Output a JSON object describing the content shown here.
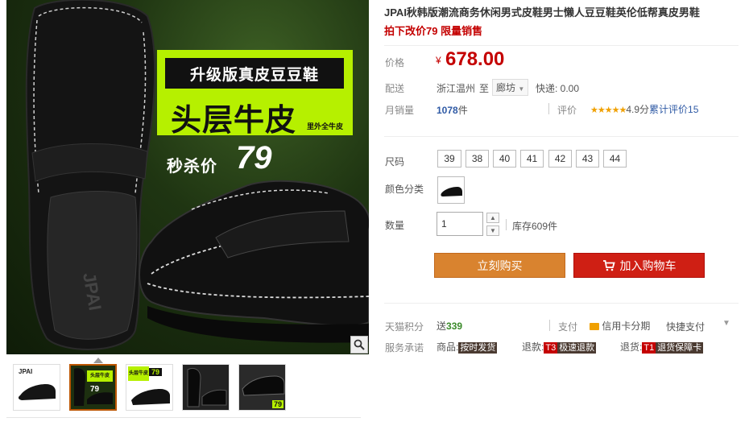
{
  "gallery": {
    "promo_headline": "升级版真皮豆豆鞋",
    "promo_big": "头层牛皮",
    "promo_small": "里外全牛皮",
    "promo_flash_label": "秒杀价",
    "promo_flash_price": "79",
    "shoe_brand_print": "JPAI",
    "thumbs": [
      {
        "label": "JPAI"
      },
      {
        "label": "头层牛皮",
        "price": "79"
      },
      {
        "label": "头层牛皮",
        "price": "79"
      },
      {
        "label": ""
      },
      {
        "label": "",
        "price": "79"
      }
    ]
  },
  "product": {
    "title": "JPAI秋韩版潮流商务休闲男式皮鞋男士懒人豆豆鞋英伦低帮真皮男鞋",
    "subtitle": "拍下改价79 限量销售",
    "price_label": "价格",
    "currency": "¥",
    "price": "678.00",
    "shipping_label": "配送",
    "ship_from": "浙江温州",
    "ship_to_word": "至",
    "ship_dest": "廊坊",
    "ship_fee": "快递: 0.00",
    "monthly_sales_label": "月销量",
    "monthly_sales_value": "1078",
    "monthly_sales_unit": "件",
    "review_label": "评价",
    "stars": "★★★★★",
    "rating": "4.9分",
    "review_count_label": "累计评价",
    "review_count": "15",
    "size_label": "尺码",
    "sizes": [
      "39",
      "38",
      "40",
      "41",
      "42",
      "43",
      "44"
    ],
    "color_label": "颜色分类",
    "qty_label": "数量",
    "qty_value": "1",
    "stock": "库存609件",
    "buy_now": "立刻购买",
    "add_cart": "加入购物车",
    "points_label": "天猫积分",
    "points_prefix": "送",
    "points_value": "339",
    "pay_label": "支付",
    "pay_credit": "信用卡分期",
    "pay_quick": "快捷支付",
    "service_label": "服务承诺",
    "service_goods": "商品:",
    "service_goods_tag": "按时发货",
    "service_refund": "退款:",
    "service_refund_t": "T3",
    "service_refund_tag": "极速退款",
    "service_return": "退货:",
    "service_return_t": "T1",
    "service_return_tag": "退货保障卡"
  },
  "colors": {
    "price_red": "#c40000",
    "buy_orange": "#d9832f",
    "cart_red": "#cf1f14",
    "promo_green": "#b6f000",
    "star_orange": "#f0a000"
  }
}
